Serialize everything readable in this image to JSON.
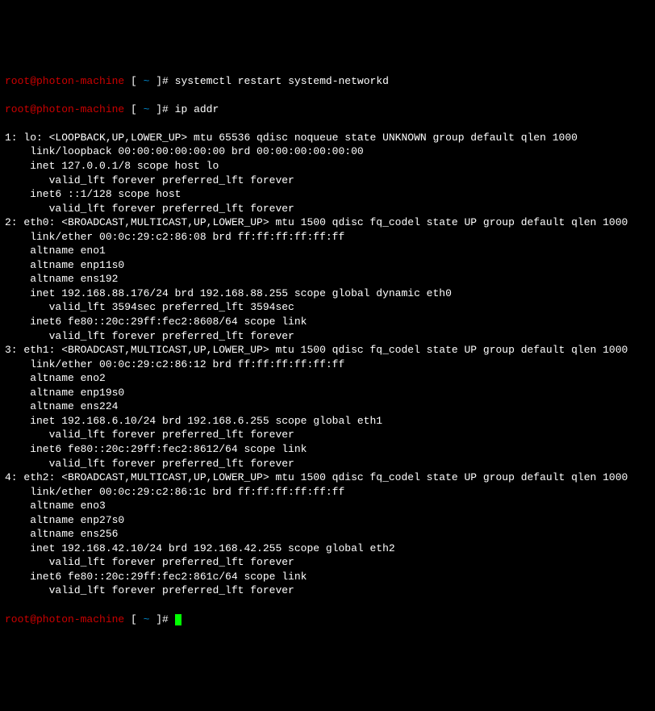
{
  "prompt": {
    "user_host": "root@photon-machine",
    "open_bracket": " [ ",
    "tilde": "~",
    "close_bracket": " ]# "
  },
  "commands": {
    "cmd1": "systemctl restart systemd-networkd",
    "cmd2": "ip addr"
  },
  "output_lines": [
    "1: lo: <LOOPBACK,UP,LOWER_UP> mtu 65536 qdisc noqueue state UNKNOWN group default qlen 1000",
    "    link/loopback 00:00:00:00:00:00 brd 00:00:00:00:00:00",
    "    inet 127.0.0.1/8 scope host lo",
    "       valid_lft forever preferred_lft forever",
    "    inet6 ::1/128 scope host",
    "       valid_lft forever preferred_lft forever",
    "2: eth0: <BROADCAST,MULTICAST,UP,LOWER_UP> mtu 1500 qdisc fq_codel state UP group default qlen 1000",
    "    link/ether 00:0c:29:c2:86:08 brd ff:ff:ff:ff:ff:ff",
    "    altname eno1",
    "    altname enp11s0",
    "    altname ens192",
    "    inet 192.168.88.176/24 brd 192.168.88.255 scope global dynamic eth0",
    "       valid_lft 3594sec preferred_lft 3594sec",
    "    inet6 fe80::20c:29ff:fec2:8608/64 scope link",
    "       valid_lft forever preferred_lft forever",
    "3: eth1: <BROADCAST,MULTICAST,UP,LOWER_UP> mtu 1500 qdisc fq_codel state UP group default qlen 1000",
    "    link/ether 00:0c:29:c2:86:12 brd ff:ff:ff:ff:ff:ff",
    "    altname eno2",
    "    altname enp19s0",
    "    altname ens224",
    "    inet 192.168.6.10/24 brd 192.168.6.255 scope global eth1",
    "       valid_lft forever preferred_lft forever",
    "    inet6 fe80::20c:29ff:fec2:8612/64 scope link",
    "       valid_lft forever preferred_lft forever",
    "4: eth2: <BROADCAST,MULTICAST,UP,LOWER_UP> mtu 1500 qdisc fq_codel state UP group default qlen 1000",
    "    link/ether 00:0c:29:c2:86:1c brd ff:ff:ff:ff:ff:ff",
    "    altname eno3",
    "    altname enp27s0",
    "    altname ens256",
    "    inet 192.168.42.10/24 brd 192.168.42.255 scope global eth2",
    "       valid_lft forever preferred_lft forever",
    "    inet6 fe80::20c:29ff:fec2:861c/64 scope link",
    "       valid_lft forever preferred_lft forever"
  ]
}
